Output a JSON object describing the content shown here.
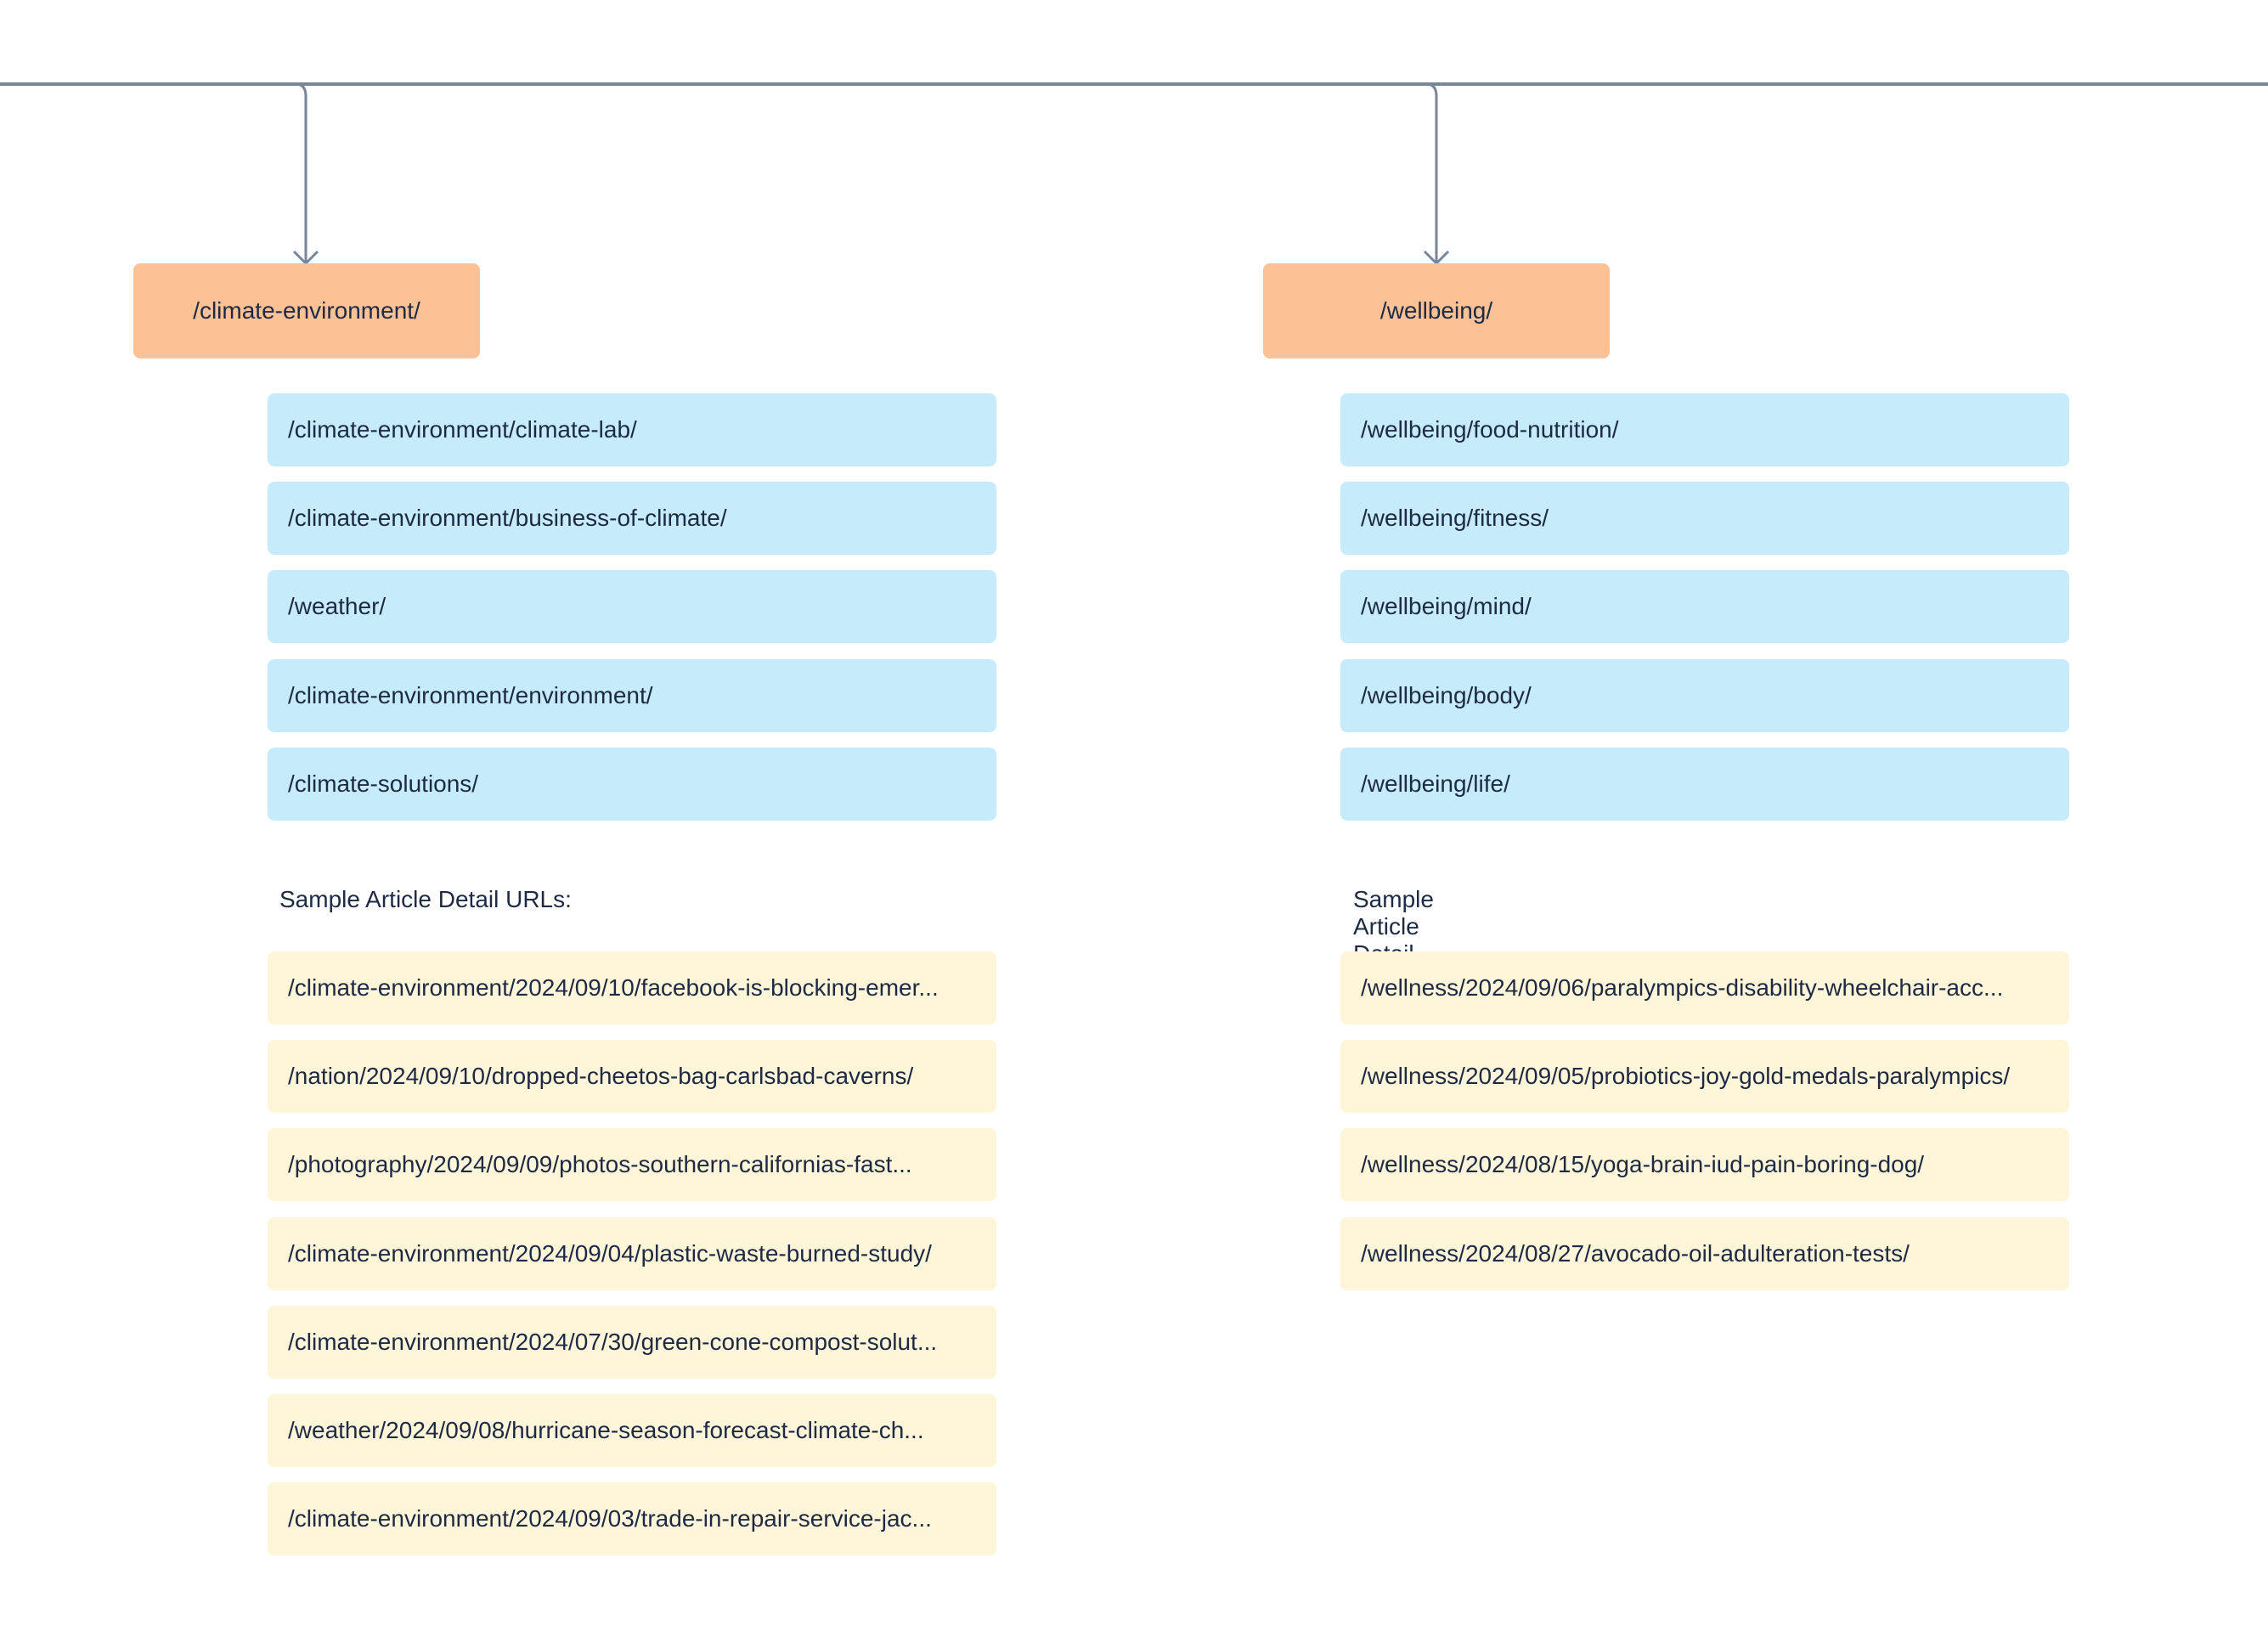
{
  "colors": {
    "connector": "#7a8599",
    "section_node": "#fcc296",
    "subsection_node": "#c6ebfa",
    "article_node": "#fff5d8",
    "text": "#1e2a44"
  },
  "sections": [
    {
      "title": "/climate-environment/",
      "subsections": [
        "/climate-environment/climate-lab/",
        "/climate-environment/business-of-climate/",
        "/weather/",
        "/climate-environment/environment/",
        "/climate-solutions/"
      ],
      "samples_label": "Sample Article Detail URLs:",
      "articles": [
        "/climate-environment/2024/09/10/facebook-is-blocking-emer...",
        "/nation/2024/09/10/dropped-cheetos-bag-carlsbad-caverns/",
        "/photography/2024/09/09/photos-southern-californias-fast...",
        "/climate-environment/2024/09/04/plastic-waste-burned-study/",
        "/climate-environment/2024/07/30/green-cone-compost-solut...",
        "/weather/2024/09/08/hurricane-season-forecast-climate-ch...",
        "/climate-environment/2024/09/03/trade-in-repair-service-jac..."
      ]
    },
    {
      "title": "/wellbeing/",
      "subsections": [
        "/wellbeing/food-nutrition/",
        "/wellbeing/fitness/",
        "/wellbeing/mind/",
        "/wellbeing/body/",
        "/wellbeing/life/"
      ],
      "samples_label": "Sample Article Detail URLs:",
      "articles": [
        "/wellness/2024/09/06/paralympics-disability-wheelchair-acc...",
        "/wellness/2024/09/05/probiotics-joy-gold-medals-paralympics/",
        "/wellness/2024/08/15/yoga-brain-iud-pain-boring-dog/",
        "/wellness/2024/08/27/avocado-oil-adulteration-tests/"
      ]
    }
  ]
}
